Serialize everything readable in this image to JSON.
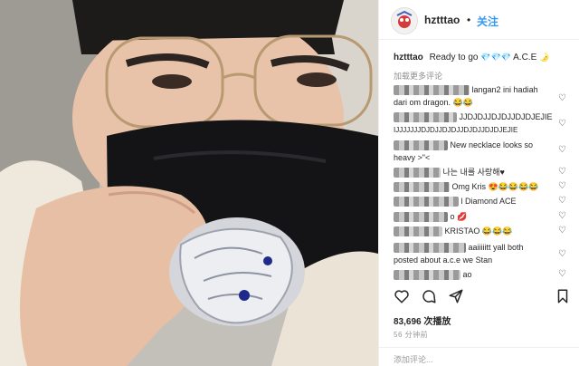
{
  "post": {
    "username": "hztttao",
    "separator": "•",
    "follow_label": "关注",
    "caption_user": "hztttao",
    "caption_text": "Ready to go",
    "caption_tail": "A.C.E",
    "caption_emoji_gem": "💎💎💎",
    "caption_emoji_moon": "🌛",
    "view_more": "加载更多评论",
    "views": "83,696 次播放",
    "time": "56 分钟前",
    "add_comment": "添加评论..."
  },
  "comments": [
    {
      "text": "langan2 ini hadiah"
    },
    {
      "text": "dari om dragon. 😂😂"
    },
    {
      "text": "JJDJDJJDJDJJDJDJEJIE"
    },
    {
      "text": "IJJJJJJJDJDJJDJDJJDJDJJDJDJEJIE"
    },
    {
      "text": "New necklace looks so"
    },
    {
      "text": "heavy >\"<"
    },
    {
      "text": "나는 내를 사랑해♥"
    },
    {
      "text": "Omg Kris 😍😂😂😂😂"
    },
    {
      "text": "l Diamond ACE"
    },
    {
      "text": "o 💋"
    },
    {
      "text": "KRISTAO 😂😂😂"
    },
    {
      "text": "aaiiiiitt yall both"
    },
    {
      "text": "posted about a.c.e we Stan"
    },
    {
      "text": "ao"
    }
  ],
  "icons": {
    "heart": "heart-icon",
    "comment": "comment-icon",
    "share": "share-icon",
    "bookmark": "bookmark-icon"
  },
  "colors": {
    "link": "#3897f0",
    "text": "#262626",
    "muted": "#8e8e8e"
  }
}
